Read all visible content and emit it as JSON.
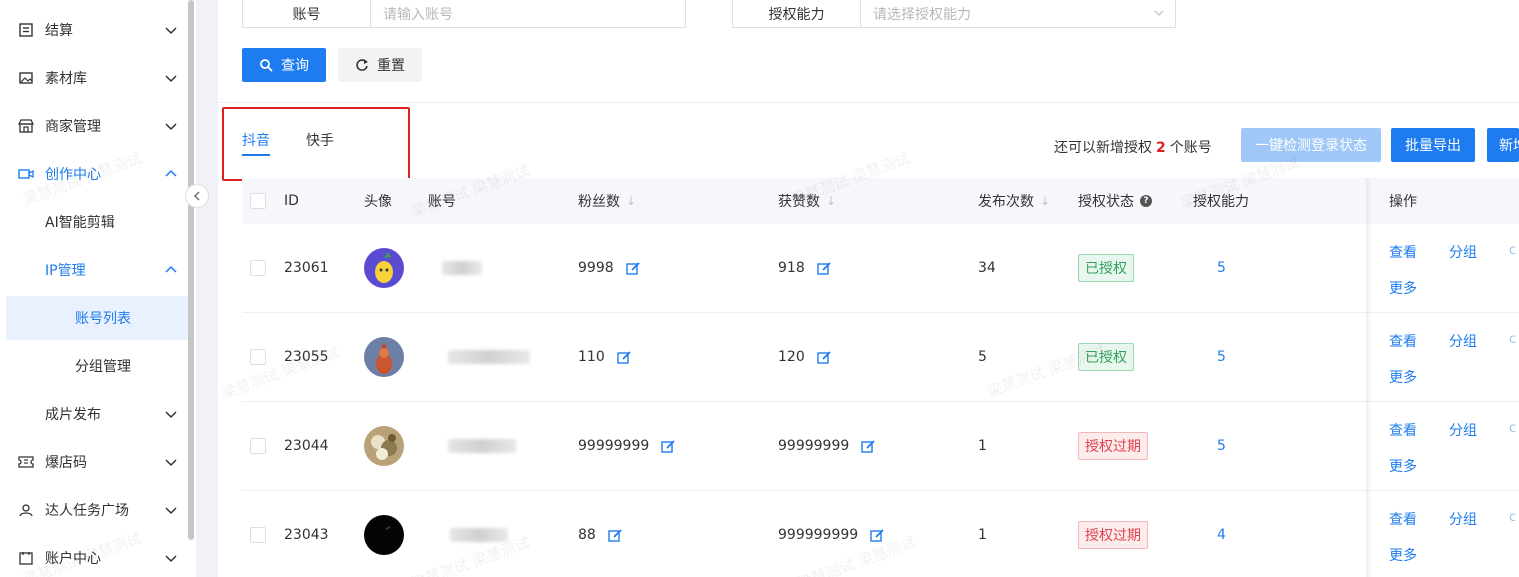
{
  "sidebar": {
    "items": [
      {
        "label": "结算",
        "icon": "receipt-icon"
      },
      {
        "label": "素材库",
        "icon": "image-icon"
      },
      {
        "label": "商家管理",
        "icon": "shop-icon"
      },
      {
        "label": "创作中心",
        "icon": "video-camera-icon"
      },
      {
        "label": "AI智能剪辑"
      },
      {
        "label": "IP管理"
      },
      {
        "label": "账号列表"
      },
      {
        "label": "分组管理"
      },
      {
        "label": "成片发布"
      },
      {
        "label": "爆店码",
        "icon": "ticket-icon"
      },
      {
        "label": "达人任务广场",
        "icon": "user-task-icon"
      },
      {
        "label": "账户中心",
        "icon": "account-icon"
      }
    ]
  },
  "filters": {
    "account_label": "账号",
    "account_placeholder": "请输入账号",
    "capability_label": "授权能力",
    "capability_placeholder": "请选择授权能力"
  },
  "actions": {
    "search_label": "查询",
    "reset_label": "重置",
    "check_login_label": "一键检测登录状态",
    "export_label": "批量导出",
    "new_label": "新增"
  },
  "tabs": [
    {
      "label": "抖音",
      "active": true
    },
    {
      "label": "快手",
      "active": false
    }
  ],
  "quota": {
    "prefix": "还可以新增授权",
    "count": "2",
    "suffix": "个账号"
  },
  "table": {
    "headers": {
      "id": "ID",
      "avatar": "头像",
      "account": "账号",
      "fans": "粉丝数",
      "likes": "获赞数",
      "posts": "发布次数",
      "auth_status": "授权状态",
      "capability": "授权能力",
      "ops": "操作"
    },
    "rows": [
      {
        "id": "23061",
        "fans": "9998",
        "likes": "918",
        "posts": "34",
        "status": "已授权",
        "status_type": "ok",
        "capability": "5"
      },
      {
        "id": "23055",
        "fans": "110",
        "likes": "120",
        "posts": "5",
        "status": "已授权",
        "status_type": "ok",
        "capability": "5"
      },
      {
        "id": "23044",
        "fans": "99999999",
        "likes": "99999999",
        "posts": "1",
        "status": "授权过期",
        "status_type": "expired",
        "capability": "5"
      },
      {
        "id": "23043",
        "fans": "88",
        "likes": "999999999",
        "posts": "1",
        "status": "授权过期",
        "status_type": "expired",
        "capability": "4"
      }
    ],
    "ops": {
      "view": "查看",
      "group": "分组",
      "more": "更多",
      "extra": "c"
    }
  },
  "watermark_text": "梁慧测试 梁慧测试",
  "colors": {
    "accent": "#1e7cf0",
    "danger": "#e02020",
    "success": "#2fa35e"
  }
}
